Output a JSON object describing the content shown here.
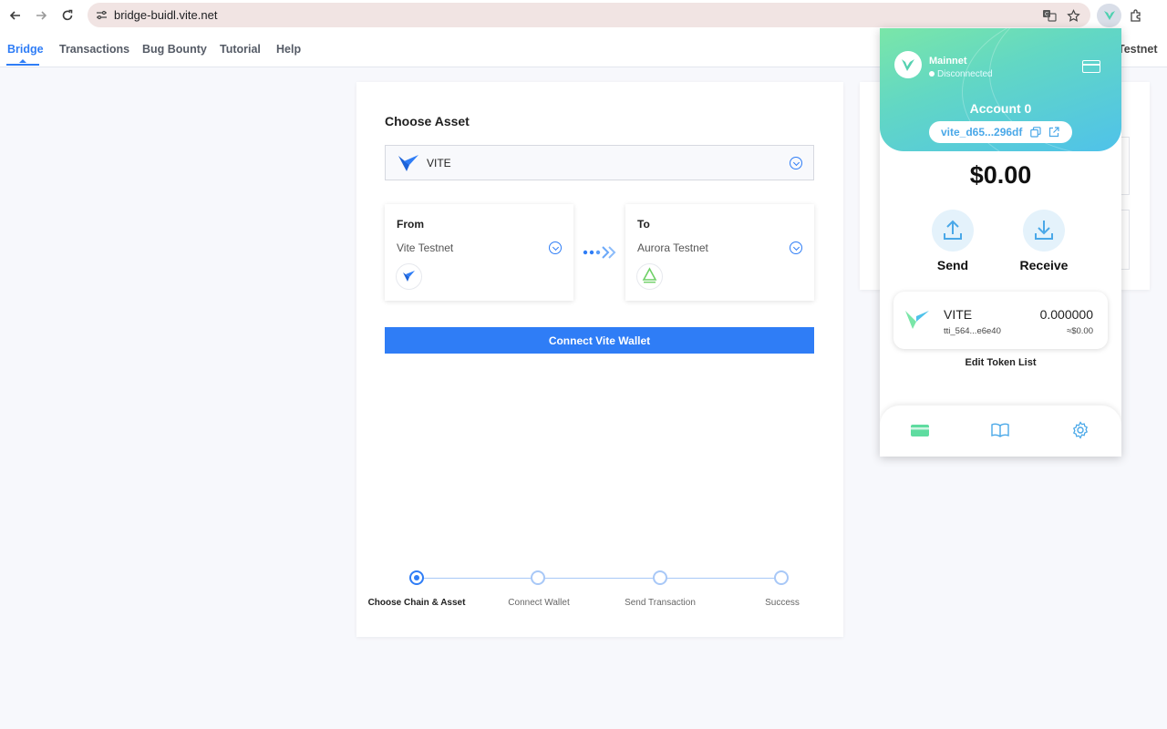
{
  "browser": {
    "url": "bridge-buidl.vite.net"
  },
  "nav": {
    "items": [
      {
        "label": "Bridge"
      },
      {
        "label": "Transactions"
      },
      {
        "label": "Bug Bounty"
      },
      {
        "label": "Tutorial"
      },
      {
        "label": "Help"
      }
    ],
    "network_label": "Testnet"
  },
  "bridge": {
    "title": "Choose Asset",
    "asset": "VITE",
    "from": {
      "heading": "From",
      "chain": "Vite Testnet"
    },
    "to": {
      "heading": "To",
      "chain": "Aurora Testnet"
    },
    "connect_label": "Connect Vite Wallet",
    "steps": [
      {
        "label": "Choose Chain & Asset"
      },
      {
        "label": "Connect Wallet"
      },
      {
        "label": "Send Transaction"
      },
      {
        "label": "Success"
      }
    ]
  },
  "wallet": {
    "network": "Mainnet",
    "status": "Disconnected",
    "account": "Account 0",
    "address": "vite_d65...296df",
    "balance": "$0.00",
    "send_label": "Send",
    "receive_label": "Receive",
    "token": {
      "symbol": "VITE",
      "id": "tti_564...e6e40",
      "amount": "0.000000",
      "fiat": "≈$0.00"
    },
    "edit_tokens_label": "Edit Token List"
  },
  "colors": {
    "accent": "#2f7df6",
    "wallet_gradient_start": "#7ae6a8",
    "wallet_gradient_end": "#4fc2ea"
  }
}
